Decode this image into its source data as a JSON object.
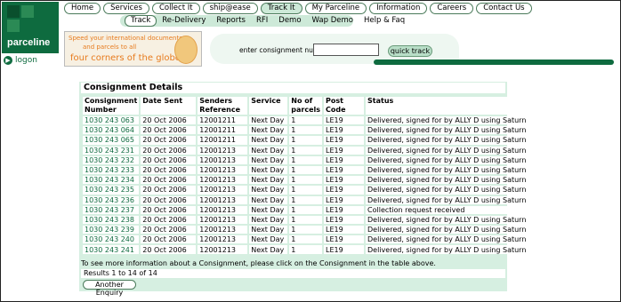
{
  "brand": {
    "logo_text": "parceline",
    "logon_label": "logon"
  },
  "nav_primary": [
    {
      "label": "Home",
      "active": false
    },
    {
      "label": "Services",
      "active": false
    },
    {
      "label": "Collect It",
      "active": false
    },
    {
      "label": "ship@ease",
      "active": false
    },
    {
      "label": "Track It",
      "active": true
    },
    {
      "label": "My Parceline",
      "active": false
    },
    {
      "label": "Information",
      "active": false
    },
    {
      "label": "Careers",
      "active": false
    },
    {
      "label": "Contact Us",
      "active": false
    }
  ],
  "nav_secondary": [
    {
      "label": "Track",
      "active": true
    },
    {
      "label": "Re-Delivery",
      "active": false
    },
    {
      "label": "Reports",
      "active": false
    },
    {
      "label": "RFI",
      "active": false
    },
    {
      "label": "Demo",
      "active": false
    },
    {
      "label": "Wap Demo",
      "active": false
    },
    {
      "label": "Help & Faq",
      "active": false
    }
  ],
  "banner": {
    "line1": "Speed your international documents",
    "line2": "and parcels to all",
    "line3": "four corners of the globe"
  },
  "track": {
    "label": "enter consignment number",
    "input_value": "",
    "button_label": "quick track"
  },
  "consignments": {
    "title": "Consignment Details",
    "columns": [
      "Consignment Number",
      "Date Sent",
      "Senders Reference",
      "Service",
      "No of parcels",
      "Post Code",
      "Status"
    ],
    "rows": [
      [
        "1030 243 063",
        "20 Oct 2006",
        "12001211",
        "Next Day",
        "1",
        "LE19",
        "Delivered, signed for by ALLY D using Saturn"
      ],
      [
        "1030 243 064",
        "20 Oct 2006",
        "12001211",
        "Next Day",
        "1",
        "LE19",
        "Delivered, signed for by ALLY D using Saturn"
      ],
      [
        "1030 243 065",
        "20 Oct 2006",
        "12001211",
        "Next Day",
        "1",
        "LE19",
        "Delivered, signed for by ALLY D using Saturn"
      ],
      [
        "1030 243 231",
        "20 Oct 2006",
        "12001213",
        "Next Day",
        "1",
        "LE19",
        "Delivered, signed for by ALLY D using Saturn"
      ],
      [
        "1030 243 232",
        "20 Oct 2006",
        "12001213",
        "Next Day",
        "1",
        "LE19",
        "Delivered, signed for by ALLY D using Saturn"
      ],
      [
        "1030 243 233",
        "20 Oct 2006",
        "12001213",
        "Next Day",
        "1",
        "LE19",
        "Delivered, signed for by ALLY D using Saturn"
      ],
      [
        "1030 243 234",
        "20 Oct 2006",
        "12001213",
        "Next Day",
        "1",
        "LE19",
        "Delivered, signed for by ALLY D using Saturn"
      ],
      [
        "1030 243 235",
        "20 Oct 2006",
        "12001213",
        "Next Day",
        "1",
        "LE19",
        "Delivered, signed for by ALLY D using Saturn"
      ],
      [
        "1030 243 236",
        "20 Oct 2006",
        "12001213",
        "Next Day",
        "1",
        "LE19",
        "Delivered, signed for by ALLY D using Saturn"
      ],
      [
        "1030 243 237",
        "20 Oct 2006",
        "12001213",
        "Next Day",
        "1",
        "LE19",
        "Collection request received"
      ],
      [
        "1030 243 238",
        "20 Oct 2006",
        "12001213",
        "Next Day",
        "1",
        "LE19",
        "Delivered, signed for by ALLY D using Saturn"
      ],
      [
        "1030 243 239",
        "20 Oct 2006",
        "12001213",
        "Next Day",
        "1",
        "LE19",
        "Delivered, signed for by ALLY D using Saturn"
      ],
      [
        "1030 243 240",
        "20 Oct 2006",
        "12001213",
        "Next Day",
        "1",
        "LE19",
        "Delivered, signed for by ALLY D using Saturn"
      ],
      [
        "1030 243 241",
        "20 Oct 2006",
        "12001213",
        "Next Day",
        "1",
        "LE19",
        "Delivered, signed for by ALLY D using Saturn"
      ]
    ],
    "note": "To see more information about a Consignment, please click on the Consignment in the table above.",
    "results": "Results 1 to 14 of 14",
    "another_button": "Another Enquiry"
  },
  "colors": {
    "brand_green": "#0e6b3f",
    "panel_green": "#d6efe1",
    "banner_orange": "#e77b1e"
  }
}
